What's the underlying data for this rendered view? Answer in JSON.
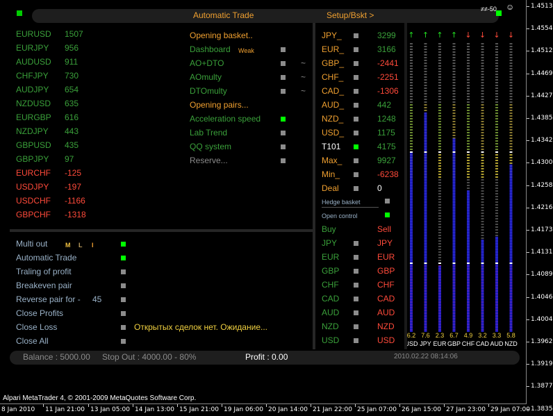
{
  "header": {
    "title": "Automatic Trade",
    "setup_link": "Setup/Bskt >",
    "corner_text": "≠≠-50"
  },
  "pairs": [
    {
      "name": "EURUSD",
      "value": "1507",
      "color": "green"
    },
    {
      "name": "EURJPY",
      "value": "956",
      "color": "green"
    },
    {
      "name": "AUDUSD",
      "value": "911",
      "color": "green"
    },
    {
      "name": "CHFJPY",
      "value": "730",
      "color": "green"
    },
    {
      "name": "AUDJPY",
      "value": "654",
      "color": "green"
    },
    {
      "name": "NZDUSD",
      "value": "635",
      "color": "green"
    },
    {
      "name": "EURGBP",
      "value": "616",
      "color": "green"
    },
    {
      "name": "NZDJPY",
      "value": "443",
      "color": "green"
    },
    {
      "name": "GBPUSD",
      "value": "435",
      "color": "green"
    },
    {
      "name": "GBPJPY",
      "value": "97",
      "color": "green"
    },
    {
      "name": "EURCHF",
      "value": "-125",
      "color": "red"
    },
    {
      "name": "USDJPY",
      "value": "-197",
      "color": "red"
    },
    {
      "name": "USDCHF",
      "value": "-1166",
      "color": "red"
    },
    {
      "name": "GBPCHF",
      "value": "-1318",
      "color": "red"
    }
  ],
  "strategies": [
    {
      "label": "Opening basket..",
      "color": "orange",
      "toggle": null,
      "extra": ""
    },
    {
      "label": "Dashboard",
      "color": "green",
      "toggle": "off",
      "extra": "",
      "tag": "Weak"
    },
    {
      "label": "AO+DTO",
      "color": "green",
      "toggle": "off",
      "extra": "~"
    },
    {
      "label": "AOmulty",
      "color": "green",
      "toggle": "off",
      "extra": "~"
    },
    {
      "label": "DTOmulty",
      "color": "green",
      "toggle": "off",
      "extra": "~"
    },
    {
      "label": "Opening pairs...",
      "color": "orange",
      "toggle": null,
      "extra": ""
    },
    {
      "label": "Acceleration speed",
      "color": "green",
      "toggle": "on",
      "extra": ""
    },
    {
      "label": "Lab Trend",
      "color": "green",
      "toggle": "off",
      "extra": ""
    },
    {
      "label": "QQ system",
      "color": "green",
      "toggle": "off",
      "extra": ""
    },
    {
      "label": "Reserve...",
      "color": "gray",
      "toggle": "off",
      "extra": ""
    }
  ],
  "currencies": [
    {
      "name": "JPY_",
      "value": "3299",
      "color": "green",
      "toggle": "off"
    },
    {
      "name": "EUR_",
      "value": "3166",
      "color": "green",
      "toggle": "off"
    },
    {
      "name": "GBP_",
      "value": "-2441",
      "color": "red",
      "toggle": "off"
    },
    {
      "name": "CHF_",
      "value": "-2251",
      "color": "red",
      "toggle": "off"
    },
    {
      "name": "CAD_",
      "value": "-1306",
      "color": "red",
      "toggle": "off"
    },
    {
      "name": "AUD_",
      "value": "442",
      "color": "green",
      "toggle": "off"
    },
    {
      "name": "NZD_",
      "value": "1248",
      "color": "green",
      "toggle": "off"
    },
    {
      "name": "USD_",
      "value": "1175",
      "color": "green",
      "toggle": "off"
    },
    {
      "name": "T101",
      "value": "4175",
      "color": "green",
      "toggle": "on"
    },
    {
      "name": "Max_",
      "value": "9927",
      "color": "green",
      "toggle": "off"
    },
    {
      "name": "Min_",
      "value": "-6238",
      "color": "red",
      "toggle": "off"
    },
    {
      "name": "Deal",
      "value": "0",
      "color": "white",
      "toggle": "off"
    }
  ],
  "hedge": {
    "label": "Hedge basket",
    "open_control": "Open control"
  },
  "buysell": {
    "buy_label": "Buy",
    "sell_label": "Sell",
    "rows": [
      "JPY",
      "EUR",
      "GBP",
      "CHF",
      "CAD",
      "AUD",
      "NZD",
      "USD"
    ]
  },
  "controls": [
    {
      "label": "Multi out",
      "toggle": "on",
      "flags": [
        "M",
        "L",
        "I"
      ]
    },
    {
      "label": "Automatic Trade",
      "toggle": "on"
    },
    {
      "label": "Traling of profit",
      "toggle": "off"
    },
    {
      "label": "Breakeven pair",
      "toggle": "off"
    },
    {
      "label": "Reverse pair for  -",
      "toggle": "off",
      "value": "45"
    },
    {
      "label": "Close Profits",
      "toggle": "off"
    },
    {
      "label": "Close Loss",
      "toggle": "off"
    },
    {
      "label": "Close All",
      "toggle": "off"
    }
  ],
  "status_message": "Открытых сделок нет. Ожидание...",
  "footer": {
    "balance": "Balance : 5000.00",
    "stop_out": "Stop Out : 4000.00 - 80%",
    "profit": "Profit : 0.00",
    "datetime": "2010.02.22 08:14:06"
  },
  "strength_bars": [
    {
      "currency": "USD",
      "value": "6.2",
      "arrow": "up",
      "strength": 0.62
    },
    {
      "currency": "JPY",
      "value": "7.6",
      "arrow": "up",
      "strength": 0.76
    },
    {
      "currency": "EUR",
      "value": "2.3",
      "arrow": "up",
      "strength": 0.23
    },
    {
      "currency": "GBP",
      "value": "6.7",
      "arrow": "up",
      "strength": 0.67
    },
    {
      "currency": "CHF",
      "value": "4.9",
      "arrow": "down",
      "strength": 0.49
    },
    {
      "currency": "CAD",
      "value": "3.2",
      "arrow": "down",
      "strength": 0.32
    },
    {
      "currency": "AUD",
      "value": "3.3",
      "arrow": "down",
      "strength": 0.33
    },
    {
      "currency": "NZD",
      "value": "5.8",
      "arrow": "down",
      "strength": 0.58
    }
  ],
  "copyright": "Alpari MetaTrader 4, © 2001-2009 MetaQuotes Software Corp.",
  "price_axis": [
    "1.45130",
    "1.45540",
    "1.45120",
    "1.44690",
    "1.44270",
    "1.43850",
    "1.43420",
    "1.43000",
    "1.42580",
    "1.42160",
    "1.41730",
    "1.41310",
    "1.40890",
    "1.40460",
    "1.40040",
    "1.39620",
    "1.39190",
    "1.38770",
    "1.38350"
  ],
  "time_axis": [
    "8 Jan 2010",
    "11 Jan 21:00",
    "13 Jan 05:00",
    "14 Jan 13:00",
    "15 Jan 21:00",
    "19 Jan 06:00",
    "20 Jan 14:00",
    "21 Jan 22:00",
    "25 Jan 07:00",
    "26 Jan 15:00",
    "27 Jan 23:00",
    "29 Jan 07:00"
  ],
  "colors": {
    "green": "#3aa03a",
    "red": "#ff4a3a",
    "orange": "#f0a030",
    "toggle_on": "#00ff00",
    "toggle_off": "#8c8c8c",
    "bar_blue": "#2222dd",
    "bar_red": "#ee2222"
  }
}
